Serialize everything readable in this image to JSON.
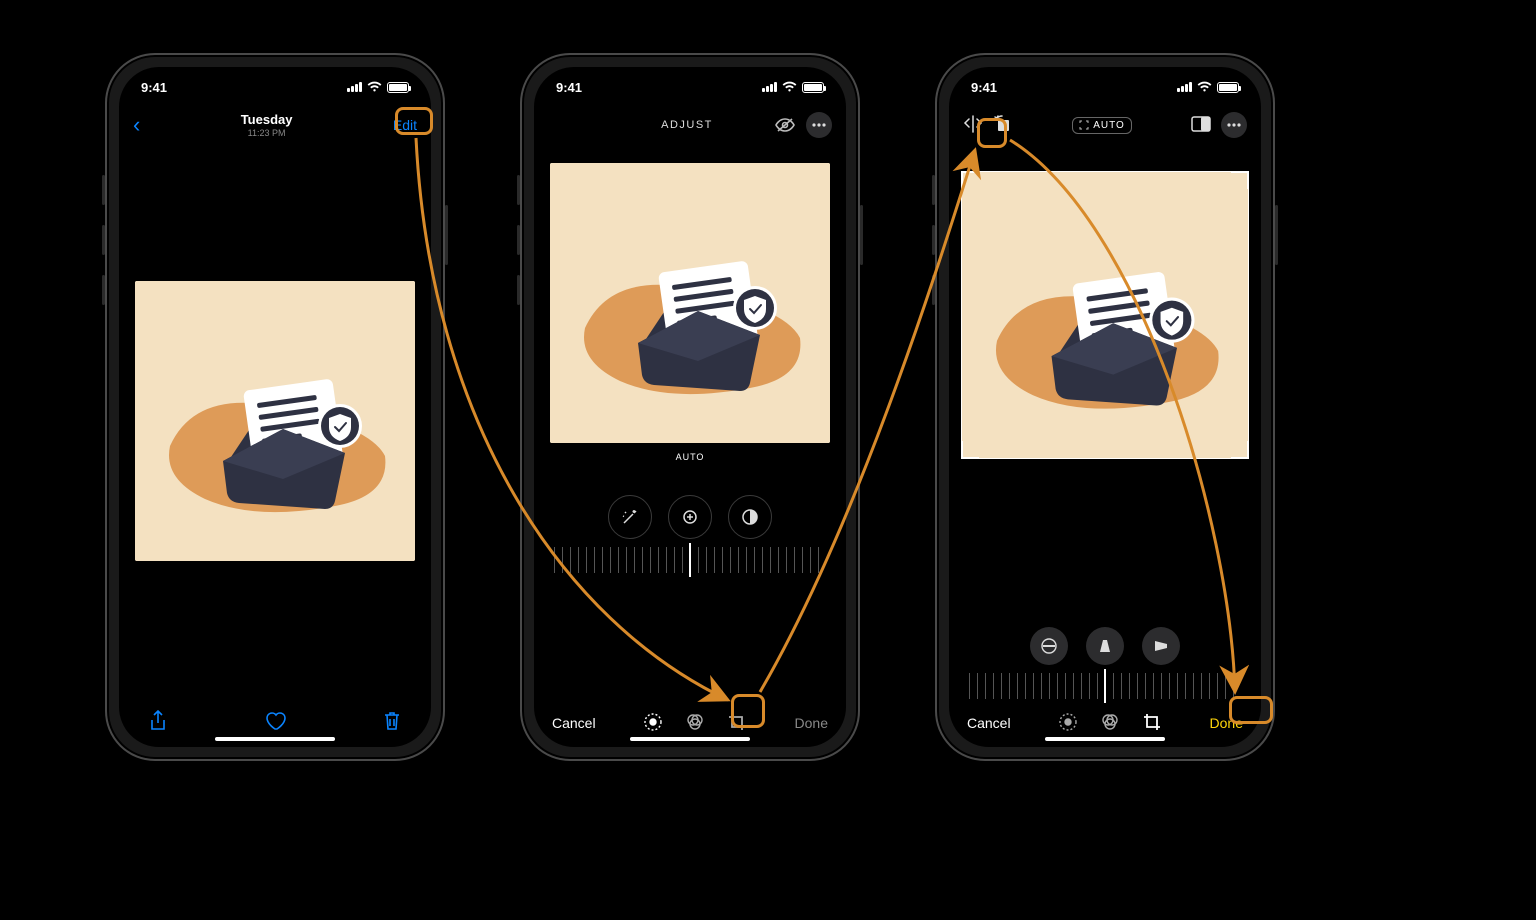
{
  "status": {
    "time": "9:41"
  },
  "phone1": {
    "title_day": "Tuesday",
    "title_time": "11:23 PM",
    "edit": "Edit"
  },
  "phone2": {
    "header": "ADJUST",
    "auto_label": "AUTO",
    "cancel": "Cancel",
    "done": "Done"
  },
  "phone3": {
    "auto_label": "AUTO",
    "cancel": "Cancel",
    "done": "Done"
  },
  "colors": {
    "highlight": "#d88a2a",
    "ios_blue": "#0a84ff",
    "ios_yellow": "#ffd60a",
    "illustration_bg": "#f4e1c1"
  }
}
